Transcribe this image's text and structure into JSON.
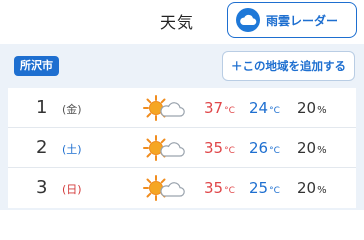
{
  "header": {
    "title": "天気",
    "radar_button_label": "雨雲レーダー"
  },
  "location": {
    "city": "所沢市",
    "add_button_label": "＋この地域を追加する"
  },
  "forecast": [
    {
      "day": "1",
      "weekday": "(金)",
      "weather_icon": "sun-cloud-icon",
      "high": "37",
      "low": "24",
      "high_unit": "°C",
      "low_unit": "°C",
      "precip": "20",
      "precip_unit": "%"
    },
    {
      "day": "2",
      "weekday": "(土)",
      "weather_icon": "sun-cloud-icon",
      "high": "35",
      "low": "26",
      "high_unit": "°C",
      "low_unit": "°C",
      "precip": "20",
      "precip_unit": "%"
    },
    {
      "day": "3",
      "weekday": "(日)",
      "weather_icon": "sun-cloud-icon",
      "high": "35",
      "low": "25",
      "high_unit": "°C",
      "low_unit": "°C",
      "precip": "20",
      "precip_unit": "%"
    }
  ],
  "colors": {
    "accent": "#1e6fd0",
    "high_temp": "#e0474a",
    "low_temp": "#1e6fd0",
    "saturday": "#1e6fd0",
    "sunday": "#d33a3a",
    "panel_bg": "#ecf2f9"
  }
}
